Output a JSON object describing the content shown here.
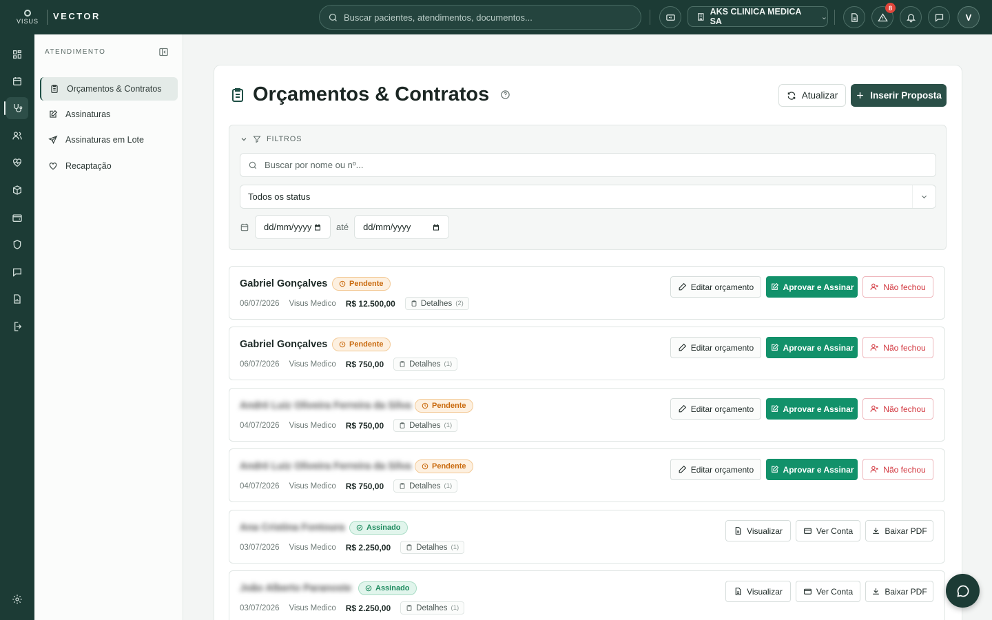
{
  "app": {
    "logo_text": "VISUS",
    "brand": "VECTOR"
  },
  "topbar": {
    "search_placeholder": "Buscar pacientes, atendimentos, documentos...",
    "org_name": "AKS CLINICA MEDICA SA",
    "alerts_count": "8",
    "avatar_initial": "V",
    "icons": [
      "monitor-icon",
      "building-icon",
      "document-icon",
      "alert-triangle-icon",
      "bell-icon",
      "message-icon"
    ]
  },
  "rail": {
    "items": [
      "dashboard-icon",
      "calendar-icon",
      "stethoscope-icon",
      "users-icon",
      "heart-pulse-icon",
      "box-icon",
      "wallet-icon",
      "shield-icon",
      "chat-icon",
      "report-icon",
      "exit-icon"
    ],
    "active": "stethoscope-icon",
    "settings_icon": "gear-icon"
  },
  "sidebar": {
    "section_title": "ATENDIMENTO",
    "items": [
      {
        "label": "Orçamentos & Contratos",
        "icon": "clipboard-icon",
        "active": true
      },
      {
        "label": "Assinaturas",
        "icon": "pen-square-icon",
        "active": false
      },
      {
        "label": "Assinaturas em Lote",
        "icon": "send-icon",
        "active": false
      },
      {
        "label": "Recaptação",
        "icon": "heart-icon",
        "active": false
      }
    ]
  },
  "page": {
    "title": "Orçamentos & Contratos",
    "refresh_label": "Atualizar",
    "insert_label": "Inserir Proposta"
  },
  "filters": {
    "title": "FILTROS",
    "search_placeholder": "Buscar por nome ou nº...",
    "status_value": "Todos os status",
    "date_from": "dd/mm/yyyy",
    "date_sep": "até",
    "date_to": "dd/mm/yyyy"
  },
  "labels": {
    "edit": "Editar orçamento",
    "approve": "Aprovar e Assinar",
    "not_closed": "Não fechou",
    "view": "Visualizar",
    "account": "Ver Conta",
    "pdf": "Baixar PDF",
    "details": "Detalhes"
  },
  "records": [
    {
      "name": "Gabriel Gonçalves",
      "blurred": false,
      "status": "Pendente",
      "date": "06/07/2026",
      "provider": "Visus Medico",
      "value": "R$ 12.500,00",
      "details_count": "(2)"
    },
    {
      "name": "Gabriel Gonçalves",
      "blurred": false,
      "status": "Pendente",
      "date": "06/07/2026",
      "provider": "Visus Medico",
      "value": "R$ 750,00",
      "details_count": "(1)"
    },
    {
      "name": "André Luiz Oliveira Ferreira da Silva",
      "blurred": true,
      "status": "Pendente",
      "date": "04/07/2026",
      "provider": "Visus Medico",
      "value": "R$ 750,00",
      "details_count": "(1)"
    },
    {
      "name": "André Luiz Oliveira Ferreira da Silva",
      "blurred": true,
      "status": "Pendente",
      "date": "04/07/2026",
      "provider": "Visus Medico",
      "value": "R$ 750,00",
      "details_count": "(1)"
    },
    {
      "name": "Ana Cristina Fontoura",
      "blurred": true,
      "status": "Assinado",
      "date": "03/07/2026",
      "provider": "Visus Medico",
      "value": "R$ 2.250,00",
      "details_count": "(1)"
    },
    {
      "name": "João Alberto Paranoste",
      "blurred": true,
      "status": "Assinado",
      "date": "03/07/2026",
      "provider": "Visus Medico",
      "value": "R$ 2.250,00",
      "details_count": "(1)"
    }
  ],
  "colors": {
    "dark_green": "#1c3b35",
    "primary_button": "#2a4f47",
    "approve_green": "#12916a",
    "pending_orange": "#c96a0e",
    "signed_green": "#1d8a5e",
    "danger_red": "#d2373f"
  }
}
